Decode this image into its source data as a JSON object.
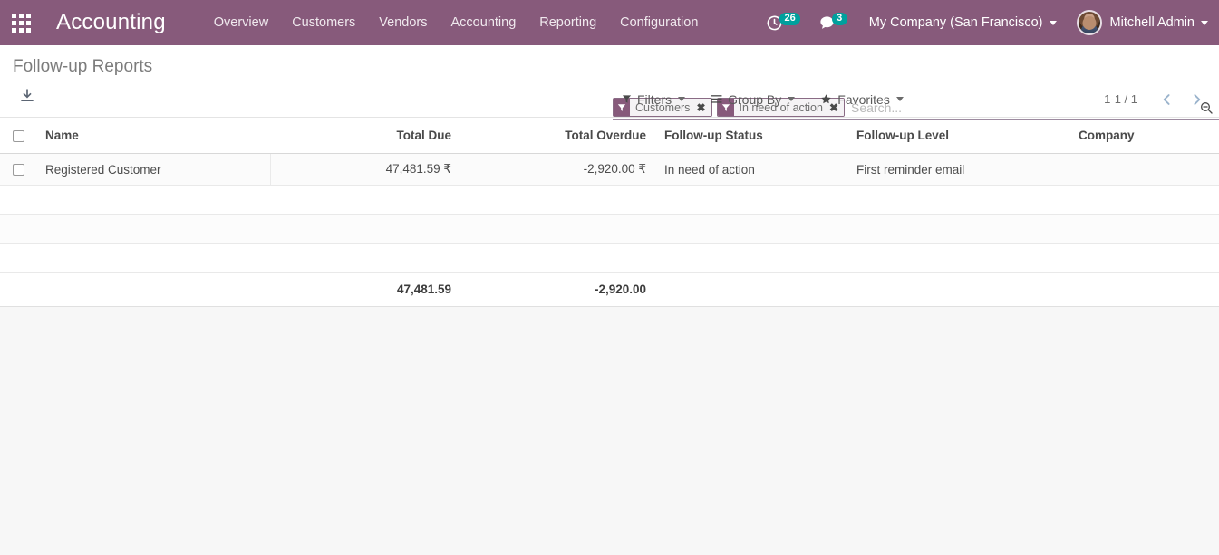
{
  "navbar": {
    "apps_icon": "apps-grid-icon",
    "brand": "Accounting",
    "menu": [
      {
        "label": "Overview"
      },
      {
        "label": "Customers"
      },
      {
        "label": "Vendors"
      },
      {
        "label": "Accounting"
      },
      {
        "label": "Reporting"
      },
      {
        "label": "Configuration"
      }
    ],
    "activity": {
      "icon": "clock-icon",
      "badge": "26"
    },
    "messages": {
      "icon": "chat-bubble-icon",
      "badge": "3"
    },
    "company": "My Company (San Francisco)",
    "user": "Mitchell Admin",
    "avatar_icon": "user-avatar",
    "brand_color": "#875A7B",
    "badge_color": "#00A09D"
  },
  "control_panel": {
    "page_title": "Follow-up Reports",
    "export_icon": "download-export-icon",
    "search": {
      "placeholder": "Search...",
      "value": "",
      "search_icon": "magnifier-minus-icon",
      "facets": [
        {
          "icon": "filter-funnel-icon",
          "label": "Customers",
          "remove": "✖"
        },
        {
          "icon": "filter-funnel-icon",
          "label": "In need of action",
          "remove": "✖"
        }
      ]
    },
    "dropdowns": [
      {
        "icon": "filter-funnel-icon",
        "label": "Filters"
      },
      {
        "icon": "group-by-icon",
        "label": "Group By"
      },
      {
        "icon": "star-icon",
        "label": "Favorites"
      }
    ],
    "pager": {
      "count": "1-1 / 1",
      "prev_icon": "chevron-left-icon",
      "next_icon": "chevron-right-icon"
    }
  },
  "table": {
    "columns": [
      {
        "label": "Name",
        "align": "left"
      },
      {
        "label": "Total Due",
        "align": "right"
      },
      {
        "label": "Total Overdue",
        "align": "right"
      },
      {
        "label": "Follow-up Status",
        "align": "left"
      },
      {
        "label": "Follow-up Level",
        "align": "left"
      },
      {
        "label": "Company",
        "align": "left"
      }
    ],
    "rows": [
      {
        "name": "Registered Customer",
        "total_due": "47,481.59 ₹",
        "total_overdue": "-2,920.00 ₹",
        "followup_status": "In need of action",
        "followup_level": "First reminder email",
        "company": ""
      }
    ],
    "totals": {
      "total_due": "47,481.59",
      "total_overdue": "-2,920.00"
    }
  }
}
